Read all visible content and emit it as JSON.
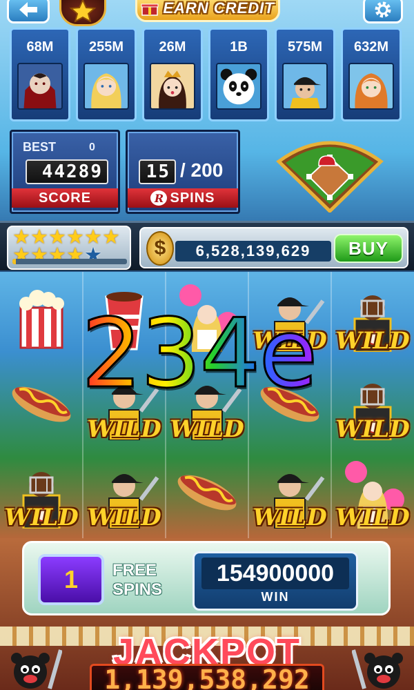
{
  "topbar": {
    "earn_credit_label": "EARN CREDIT"
  },
  "leaderboard": [
    {
      "score": "68M",
      "avatar": "vampire-avatar"
    },
    {
      "score": "255M",
      "avatar": "blonde-girl-avatar"
    },
    {
      "score": "26M",
      "avatar": "princess-avatar"
    },
    {
      "score": "1B",
      "avatar": "panda-avatar"
    },
    {
      "score": "575M",
      "avatar": "baseball-player-avatar"
    },
    {
      "score": "632M",
      "avatar": "redhead-girl-avatar"
    }
  ],
  "score_panel": {
    "best_label": "BEST",
    "best_value": "0",
    "score_value": "44289",
    "label": "SCORE"
  },
  "spins_panel": {
    "spins_used": "15",
    "spins_total": "/ 200",
    "label": "SPINS",
    "icon_letter": "R"
  },
  "status": {
    "stars_filled": 10,
    "stars_total": 11,
    "xp_progress": 0.03,
    "coin_symbol": "$",
    "coins": "6,528,139,629",
    "buy_label": "BUY"
  },
  "reels": [
    [
      "popcorn",
      "hotdog",
      "catcher-wild"
    ],
    [
      "soda-cup",
      "batter-wild",
      "batter-wild"
    ],
    [
      "cheerleader",
      "batter-wild",
      "hotdog"
    ],
    [
      "batter-wild",
      "hotdog",
      "batter-wild"
    ],
    [
      "catcher-wild",
      "catcher-wild",
      "cheerleader-wild"
    ]
  ],
  "wild_label": "WILD",
  "overlay_number": "234e",
  "bottom": {
    "free_spins_count": "1",
    "free_spins_label_line1": "FREE",
    "free_spins_label_line2": "SPINS",
    "win_value": "154900000",
    "win_label": "WIN"
  },
  "jackpot": {
    "title": "JACKPOT",
    "amount": "1,139,538,292"
  },
  "colors": {
    "panel_blue": "#2d67b6",
    "label_red": "#e0333a",
    "buy_green": "#1f9a18",
    "jackpot_red": "#ff4a5a"
  }
}
